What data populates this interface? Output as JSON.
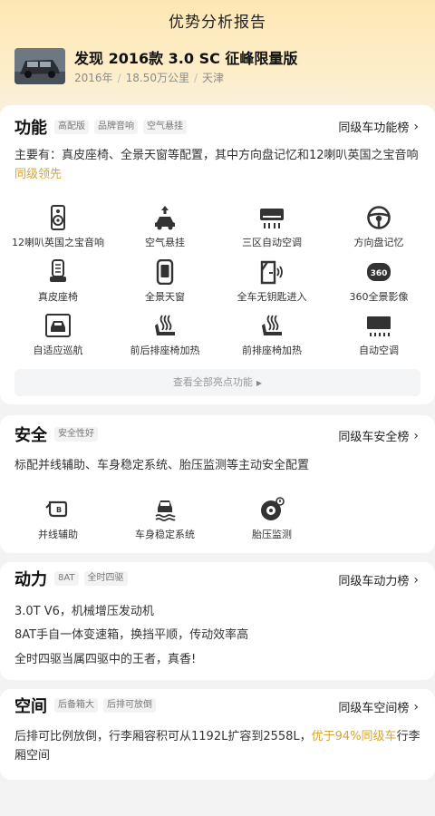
{
  "header": {
    "title": "优势分析报告",
    "car_name": "发现 2016款 3.0 SC 征峰限量版",
    "meta": [
      "2016年",
      "18.50万公里",
      "天津"
    ]
  },
  "features": {
    "title": "功能",
    "tags": [
      "高配版",
      "品牌音响",
      "空气悬挂"
    ],
    "rank_link": "同级车功能榜",
    "desc_main": "主要有：真皮座椅、全景天窗等配置，其中方向盘记忆和12喇叭英国之宝音响",
    "desc_highlight": "同级领先",
    "items": [
      {
        "label": "12喇叭英国之宝音响",
        "icon": "speaker-icon"
      },
      {
        "label": "空气悬挂",
        "icon": "air-suspension-icon"
      },
      {
        "label": "三区自动空调",
        "icon": "ac-unit-icon"
      },
      {
        "label": "方向盘记忆",
        "icon": "steering-wheel-icon"
      },
      {
        "label": "真皮座椅",
        "icon": "seat-icon"
      },
      {
        "label": "全景天窗",
        "icon": "sunroof-icon"
      },
      {
        "label": "全车无钥匙进入",
        "icon": "keyless-entry-icon"
      },
      {
        "label": "360全景影像",
        "icon": "camera-360-icon"
      },
      {
        "label": "自适应巡航",
        "icon": "adaptive-cruise-icon"
      },
      {
        "label": "前后排座椅加热",
        "icon": "seat-heating-icon"
      },
      {
        "label": "前排座椅加热",
        "icon": "seat-heating-icon"
      },
      {
        "label": "自动空调",
        "icon": "auto-ac-icon"
      }
    ],
    "more_label": "查看全部亮点功能"
  },
  "safety": {
    "title": "安全",
    "tags": [
      "安全性好"
    ],
    "rank_link": "同级车安全榜",
    "desc": "标配并线辅助、车身稳定系统、胎压监测等主动安全配置",
    "items": [
      {
        "label": "并线辅助",
        "icon": "lane-assist-icon"
      },
      {
        "label": "车身稳定系统",
        "icon": "stability-icon"
      },
      {
        "label": "胎压监测",
        "icon": "tire-pressure-icon"
      }
    ]
  },
  "power": {
    "title": "动力",
    "tags": [
      "8AT",
      "全时四驱"
    ],
    "rank_link": "同级车动力榜",
    "lines": [
      "3.0T V6，机械增压发动机",
      "8AT手自一体变速箱，换挡平顺，传动效率高",
      "全时四驱当属四驱中的王者，真香!"
    ]
  },
  "space": {
    "title": "空间",
    "tags": [
      "后备箱大",
      "后排可放倒"
    ],
    "rank_link": "同级车空间榜",
    "desc_main": "后排可比例放倒，行李厢容积可从1192L扩容到2558L，",
    "desc_highlight": "优于94%同级车",
    "desc_tail": "行李厢空间"
  },
  "colors": {
    "accent": "#d5a637",
    "hero_top": "#fde7b4",
    "icon": "#333333"
  }
}
